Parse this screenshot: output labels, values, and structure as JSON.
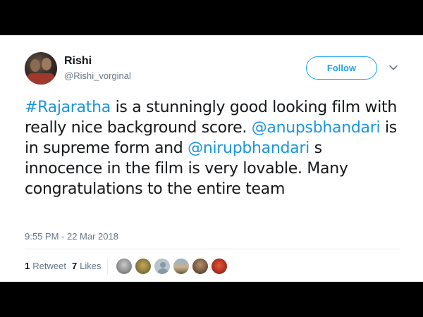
{
  "user": {
    "name": "Rishi",
    "handle": "@Rishi_vorginal"
  },
  "follow_label": "Follow",
  "tweet": {
    "hashtag": "#Rajaratha",
    "text1": " is a stunningly good looking film with really nice background score. ",
    "mention1": "@anupsbhandari",
    "text2": " is in supreme form and ",
    "mention2": "@nirupbhandari",
    "text3": " s innocence in the film is very lovable. Many congratulations to the entire team"
  },
  "timestamp": "9:55 PM - 22 Mar 2018",
  "stats": {
    "retweets_count": "1",
    "retweets_label": "Retweet",
    "likes_count": "7",
    "likes_label": "Likes"
  },
  "colors": {
    "link": "#1b95e0",
    "follow": "#1da1f2",
    "text": "#14171a",
    "muted": "#657786"
  },
  "icons": {
    "menu": "chevron-down-icon"
  }
}
